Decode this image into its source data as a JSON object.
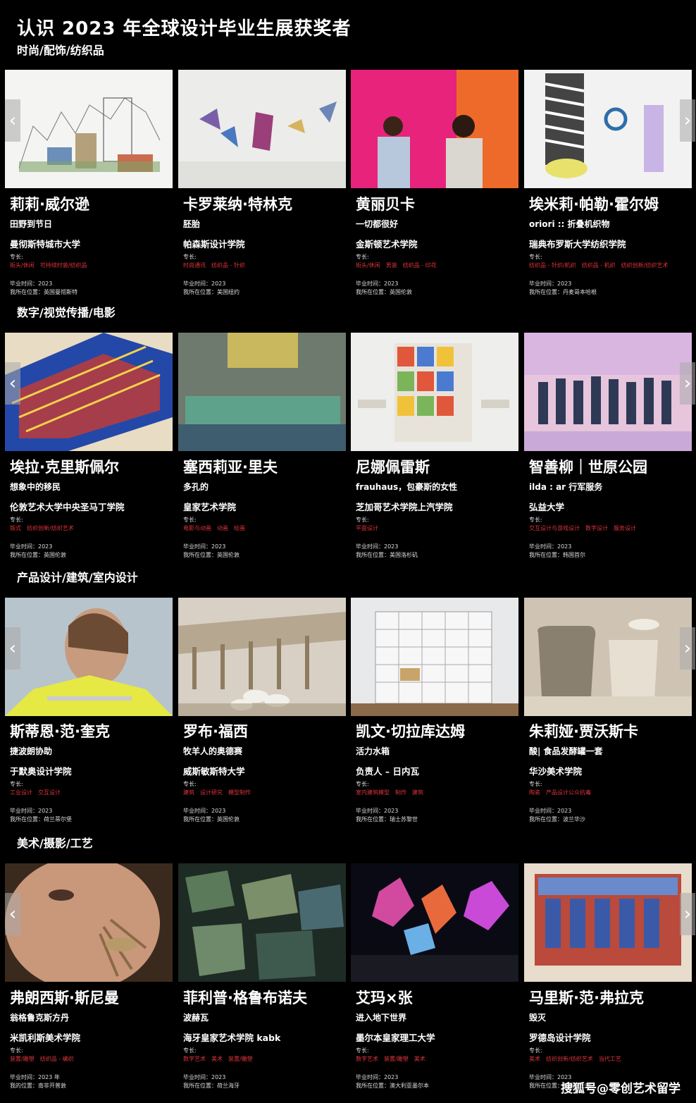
{
  "page_title": "认识 2023 年全球设计毕业生展获奖者",
  "watermark": "搜狐号@零创艺术留学",
  "arrows": {
    "left": "‹",
    "right": "›"
  },
  "sections": [
    {
      "title": "时尚/配饰/纺织品",
      "cards": [
        {
          "name": "莉莉·威尔逊",
          "work": "田野到节日",
          "school": "曼彻斯特城市大学",
          "spec_label": "专长:",
          "tags": [
            "街头/休闲",
            "可持续时装/纺织品"
          ],
          "grad": "毕业时间：2023",
          "loc": "我所在位置：英国曼彻斯特",
          "icon": "sketch-city-image"
        },
        {
          "name": "卡罗莱纳·特林克",
          "work": "胚胎",
          "school": "帕森斯设计学院",
          "spec_label": "专长:",
          "tags": [
            "时尚通讯",
            "纺织品 - 针织"
          ],
          "grad": "毕业时间：2023",
          "loc": "我所在位置：美国纽约",
          "icon": "kite-installation-image"
        },
        {
          "name": "黄丽贝卡",
          "work": "一切都很好",
          "school": "金斯顿艺术学院",
          "spec_label": "专长:",
          "tags": [
            "街头/休闲",
            "男装",
            "纺织品 - 印花"
          ],
          "grad": "毕业时间：2023",
          "loc": "我所在位置：英国伦敦",
          "icon": "models-pink-wall-image"
        },
        {
          "name": "埃米莉·帕勒·霍尔姆",
          "work": "oriori :: 折叠机织物",
          "school": "瑞典布罗斯大学纺织学院",
          "spec_label": "专长:",
          "tags": [
            "纺织品 - 针织/机织",
            "纺织品 - 机织",
            "纺织创新/纺织艺术"
          ],
          "grad": "毕业时间：2023",
          "loc": "我所在位置：丹麦哥本哈根",
          "icon": "folded-textile-image"
        }
      ]
    },
    {
      "title": "数字/视觉传播/电影",
      "cards": [
        {
          "name": "埃拉·克里斯佩尔",
          "work": "想象中的移民",
          "school": "伦敦艺术大学中央圣马丁学院",
          "spec_label": "专长:",
          "tags": [
            "版式",
            "纺织创新/纺织艺术"
          ],
          "grad": "毕业时间：2023",
          "loc": "我所在位置：英国伦敦",
          "icon": "woven-tapestry-image"
        },
        {
          "name": "塞西莉亚·里夫",
          "work": "多孔的",
          "school": "皇家艺术学院",
          "spec_label": "专长:",
          "tags": [
            "电影与动画",
            "动画",
            "绘画"
          ],
          "grad": "毕业时间：2023",
          "loc": "我所在位置：英国伦敦",
          "icon": "bathtub-image"
        },
        {
          "name": "尼娜佩雷斯",
          "work": "frauhaus，包豪斯的女性",
          "school": "芝加哥艺术学院上汽学院",
          "spec_label": "专长:",
          "tags": [
            "平面设计"
          ],
          "grad": "毕业时间：2023",
          "loc": "我所在位置：美国洛杉矶",
          "icon": "frauhaus-poster-image"
        },
        {
          "name": "智善柳｜世原公园",
          "work": "ilda : ar 行军服务",
          "school": "弘益大学",
          "spec_label": "专长:",
          "tags": [
            "交互设计与游戏设计",
            "数字设计",
            "服务设计"
          ],
          "grad": "毕业时间：2023",
          "loc": "我所在位置：韩国首尔",
          "icon": "ilda-characters-image"
        }
      ]
    },
    {
      "title": "产品设计/建筑/室内设计",
      "cards": [
        {
          "name": "斯蒂恩·范·奎克",
          "work": "捷波朗协助",
          "school": "于默奥设计学院",
          "spec_label": "专长:",
          "tags": [
            "工业设计",
            "交互设计"
          ],
          "grad": "毕业时间：2023",
          "loc": "我所在位置：荷兰蒂尔堡",
          "icon": "headset-worker-image"
        },
        {
          "name": "罗布·福西",
          "work": "牧羊人的奥德赛",
          "school": "威斯敏斯特大学",
          "spec_label": "专长:",
          "tags": [
            "建筑",
            "设计研究",
            "模型制作"
          ],
          "grad": "毕业时间：2023",
          "loc": "我所在位置：英国伦敦",
          "icon": "sheep-aqueduct-image"
        },
        {
          "name": "凯文·切拉库达姆",
          "work": "活力水箱",
          "school": "负责人 – 日内瓦",
          "spec_label": "专长:",
          "tags": [
            "室内建筑模型",
            "制作",
            "建筑"
          ],
          "grad": "毕业时间：2023",
          "loc": "我所在位置：瑞士苏黎世",
          "icon": "architecture-model-image"
        },
        {
          "name": "朱莉娅·贾沃斯卡",
          "work": "酸| 食品发酵罐一套",
          "school": "华沙美术学院",
          "spec_label": "专长:",
          "tags": [
            "陶瓷",
            "产品设计公众抗毒"
          ],
          "grad": "毕业时间：2023",
          "loc": "我所在位置：波兰华沙",
          "icon": "ceramic-jars-image"
        }
      ]
    },
    {
      "title": "美术/摄影/工艺",
      "cards": [
        {
          "name": "弗朗西斯·斯尼曼",
          "work": "翁格鲁克斯方丹",
          "school": "米凯利斯美术学院",
          "spec_label": "专长:",
          "tags": [
            "装置/雕塑",
            "纺织品 - 编织"
          ],
          "grad": "毕业时间：2023 年",
          "loc": "我的位置：南非开普敦",
          "icon": "face-insect-image"
        },
        {
          "name": "菲利普·格鲁布诺夫",
          "work": "波赫瓦",
          "school": "海牙皇家艺术学院 kabk",
          "spec_label": "专长:",
          "tags": [
            "数字艺术",
            "美术",
            "装置/雕塑"
          ],
          "grad": "毕业时间：2023",
          "loc": "我所在位置：荷兰海牙",
          "icon": "aerial-fragments-image"
        },
        {
          "name": "艾玛×张",
          "work": "进入地下世界",
          "school": "墨尔本皇家理工大学",
          "spec_label": "专长:",
          "tags": [
            "数字艺术",
            "装置/雕塑",
            "美术"
          ],
          "grad": "毕业时间：2023",
          "loc": "我所在位置：澳大利亚墨尔本",
          "icon": "light-installation-image"
        },
        {
          "name": "马里斯·范·弗拉克",
          "work": "毁灭",
          "school": "罗德岛设计学院",
          "spec_label": "专长:",
          "tags": [
            "美术",
            "纺织创新/纺织艺术",
            "当代工艺"
          ],
          "grad": "毕业时间：2023",
          "loc": "我所在位置：美国波士顿",
          "icon": "tapestry-ruins-image"
        }
      ]
    }
  ]
}
